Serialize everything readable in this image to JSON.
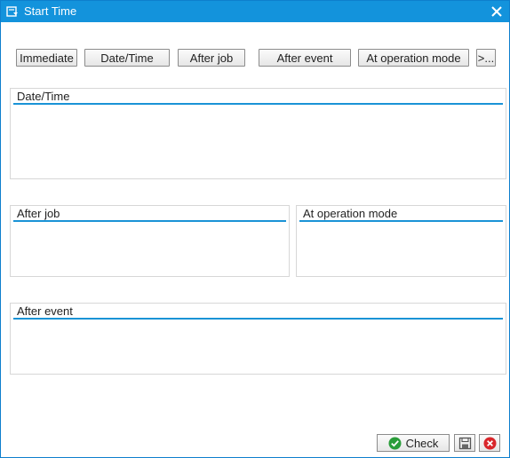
{
  "window": {
    "title": "Start Time"
  },
  "toolbar": {
    "immediate": "Immediate",
    "date_time": "Date/Time",
    "after_job": "After job",
    "after_event": "After event",
    "at_operation_mode": "At operation mode",
    "more": ">..."
  },
  "panels": {
    "date_time": "Date/Time",
    "after_job": "After job",
    "at_operation_mode": "At operation mode",
    "after_event": "After event"
  },
  "footer": {
    "check": "Check"
  },
  "colors": {
    "titlebar": "#1393dc",
    "accent_line": "#1a93d6",
    "check_green": "#2a9d3a",
    "cancel_red": "#d9262b"
  }
}
